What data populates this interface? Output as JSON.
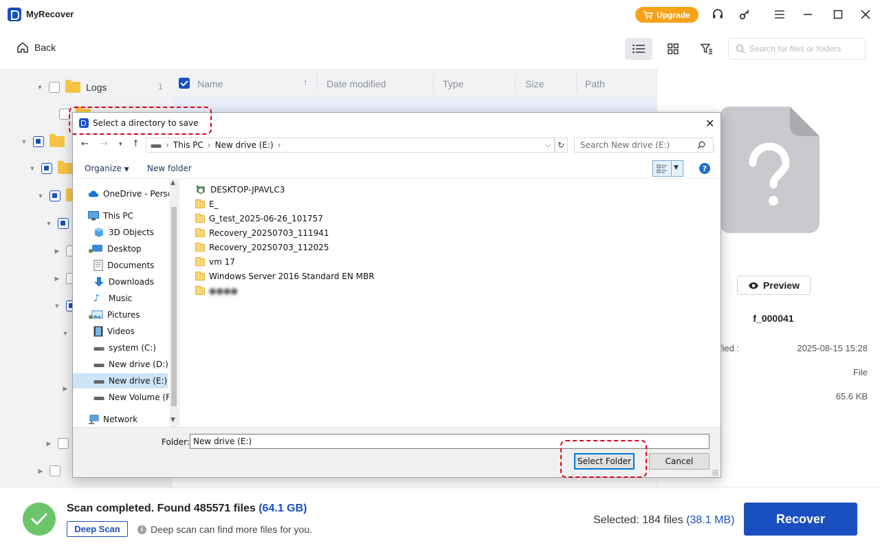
{
  "app": {
    "title": "MyRecover",
    "upgrade_label": "Upgrade"
  },
  "toolbar": {
    "back_label": "Back",
    "search_placeholder": "Search for files or folders"
  },
  "tree": {
    "items": [
      {
        "label": "Logs",
        "count": "1"
      }
    ]
  },
  "list": {
    "columns": [
      "Name",
      "Date modified",
      "Type",
      "Size",
      "Path"
    ]
  },
  "preview": {
    "preview_label": "Preview",
    "file_name": "f_000041",
    "meta": [
      {
        "label": "ified :",
        "value": "2025-08-15 15:28"
      },
      {
        "label": "",
        "value": "File"
      },
      {
        "label": "",
        "value": "65.6 KB"
      }
    ]
  },
  "bottom": {
    "scan_status": "Scan completed. Found 485571 files",
    "scan_size": "(64.1 GB)",
    "deep_scan_label": "Deep Scan",
    "deep_scan_hint": "Deep scan can find more files for you.",
    "selected_text": "Selected: 184 files",
    "selected_size": "(38.1 MB)",
    "recover_label": "Recover"
  },
  "dialog": {
    "title": "Select a directory to save",
    "breadcrumb": [
      "This PC",
      "New drive (E:)"
    ],
    "search_placeholder": "Search New drive (E:)",
    "organize_label": "Organize",
    "new_folder_label": "New folder",
    "nav_items": [
      {
        "label": "OneDrive - Person",
        "icon": "cloud-icon"
      },
      {
        "label": "This PC",
        "icon": "computer-icon"
      },
      {
        "label": "3D Objects",
        "icon": "cube-icon"
      },
      {
        "label": "Desktop",
        "icon": "desktop-icon"
      },
      {
        "label": "Documents",
        "icon": "document-icon"
      },
      {
        "label": "Downloads",
        "icon": "download-icon"
      },
      {
        "label": "Music",
        "icon": "music-icon"
      },
      {
        "label": "Pictures",
        "icon": "picture-icon"
      },
      {
        "label": "Videos",
        "icon": "video-icon"
      },
      {
        "label": "system (C:)",
        "icon": "drive-icon"
      },
      {
        "label": "New drive (D:)",
        "icon": "drive-icon"
      },
      {
        "label": "New drive (E:)",
        "icon": "drive-icon"
      },
      {
        "label": "New Volume (F:)",
        "icon": "drive-icon"
      },
      {
        "label": "Network",
        "icon": "network-icon"
      }
    ],
    "files": [
      "DESKTOP-JPAVLC3",
      "E_",
      "G_test_2025-06-26_101757",
      "Recovery_20250703_111941",
      "Recovery_20250703_112025",
      "vm 17",
      "Windows Server 2016 Standard EN MBR",
      "●●●●"
    ],
    "folder_label": "Folder:",
    "folder_value": "New drive (E:)",
    "select_label": "Select Folder",
    "cancel_label": "Cancel"
  },
  "colors": {
    "brand": "#1a4fbf",
    "upgrade": "#f7a21b",
    "success": "#6cc46b",
    "highlight": "#e00016"
  }
}
